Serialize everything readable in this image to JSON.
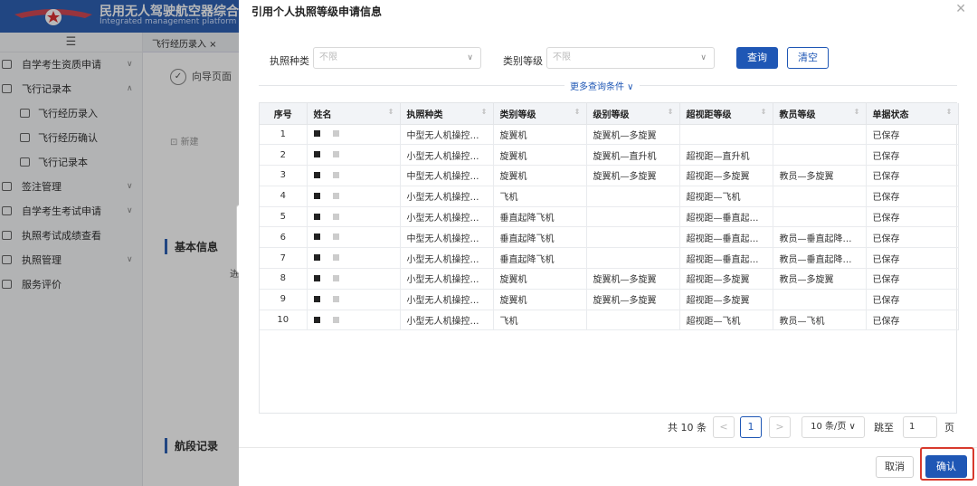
{
  "app": {
    "title": "民用无人驾驶航空器综合",
    "subtitle": "Integrated management platform of",
    "colors": {
      "header": "#2f62b5",
      "primary": "#1f57b5",
      "highlight": "#d83a2d"
    }
  },
  "sidebar": {
    "items": [
      {
        "label": "自学考生资质申请",
        "arrow": "∨"
      },
      {
        "label": "飞行记录本",
        "arrow": "∧"
      },
      {
        "label": "飞行经历录入"
      },
      {
        "label": "飞行经历确认"
      },
      {
        "label": "飞行记录本"
      },
      {
        "label": "签注管理",
        "arrow": "∨"
      },
      {
        "label": "自学考生考试申请",
        "arrow": "∨"
      },
      {
        "label": "执照考试成绩查看"
      },
      {
        "label": "执照管理",
        "arrow": "∨"
      },
      {
        "label": "服务评价"
      }
    ]
  },
  "bg": {
    "tab": "飞行经历录入 ×",
    "guide": "向导页面",
    "new_btn": "新建",
    "section_basic": "基本信息",
    "section_flight": "航段记录",
    "side_char": "进"
  },
  "drawer": {
    "title": "引用个人执照等级申请信息",
    "filters": {
      "license_label": "执照种类",
      "license_placeholder": "不限",
      "grade_label": "类别等级",
      "grade_placeholder": "不限"
    },
    "query_btn": "查询",
    "clear_btn": "清空",
    "more_conditions": "更多查询条件 ∨",
    "table": {
      "headers": [
        "序号",
        "姓名",
        "执照种类",
        "类别等级",
        "级别等级",
        "超视距等级",
        "教员等级",
        "单据状态"
      ],
      "rows": [
        [
          "1",
          "",
          "中型无人机操控…",
          "旋翼机",
          "旋翼机—多旋翼",
          "",
          "",
          "已保存"
        ],
        [
          "2",
          "",
          "小型无人机操控…",
          "旋翼机",
          "旋翼机—直升机",
          "超视距—直升机",
          "",
          "已保存"
        ],
        [
          "3",
          "",
          "中型无人机操控…",
          "旋翼机",
          "旋翼机—多旋翼",
          "超视距—多旋翼",
          "教员—多旋翼",
          "已保存"
        ],
        [
          "4",
          "",
          "小型无人机操控…",
          "飞机",
          "",
          "超视距—飞机",
          "",
          "已保存"
        ],
        [
          "5",
          "",
          "小型无人机操控…",
          "垂直起降飞机",
          "",
          "超视距—垂直起…",
          "",
          "已保存"
        ],
        [
          "6",
          "",
          "中型无人机操控…",
          "垂直起降飞机",
          "",
          "超视距—垂直起…",
          "教员—垂直起降…",
          "已保存"
        ],
        [
          "7",
          "",
          "小型无人机操控…",
          "垂直起降飞机",
          "",
          "超视距—垂直起…",
          "教员—垂直起降…",
          "已保存"
        ],
        [
          "8",
          "",
          "小型无人机操控…",
          "旋翼机",
          "旋翼机—多旋翼",
          "超视距—多旋翼",
          "教员—多旋翼",
          "已保存"
        ],
        [
          "9",
          "",
          "小型无人机操控…",
          "旋翼机",
          "旋翼机—多旋翼",
          "超视距—多旋翼",
          "",
          "已保存"
        ],
        [
          "10",
          "",
          "小型无人机操控…",
          "飞机",
          "",
          "超视距—飞机",
          "教员—飞机",
          "已保存"
        ]
      ]
    },
    "pagination": {
      "total": "共 10 条",
      "prev": "<",
      "current": "1",
      "next": ">",
      "page_size": "10 条/页 ∨",
      "jump_label": "跳至",
      "jump_value": "1",
      "page_unit": "页"
    },
    "cancel_btn": "取消",
    "confirm_btn": "确认"
  }
}
